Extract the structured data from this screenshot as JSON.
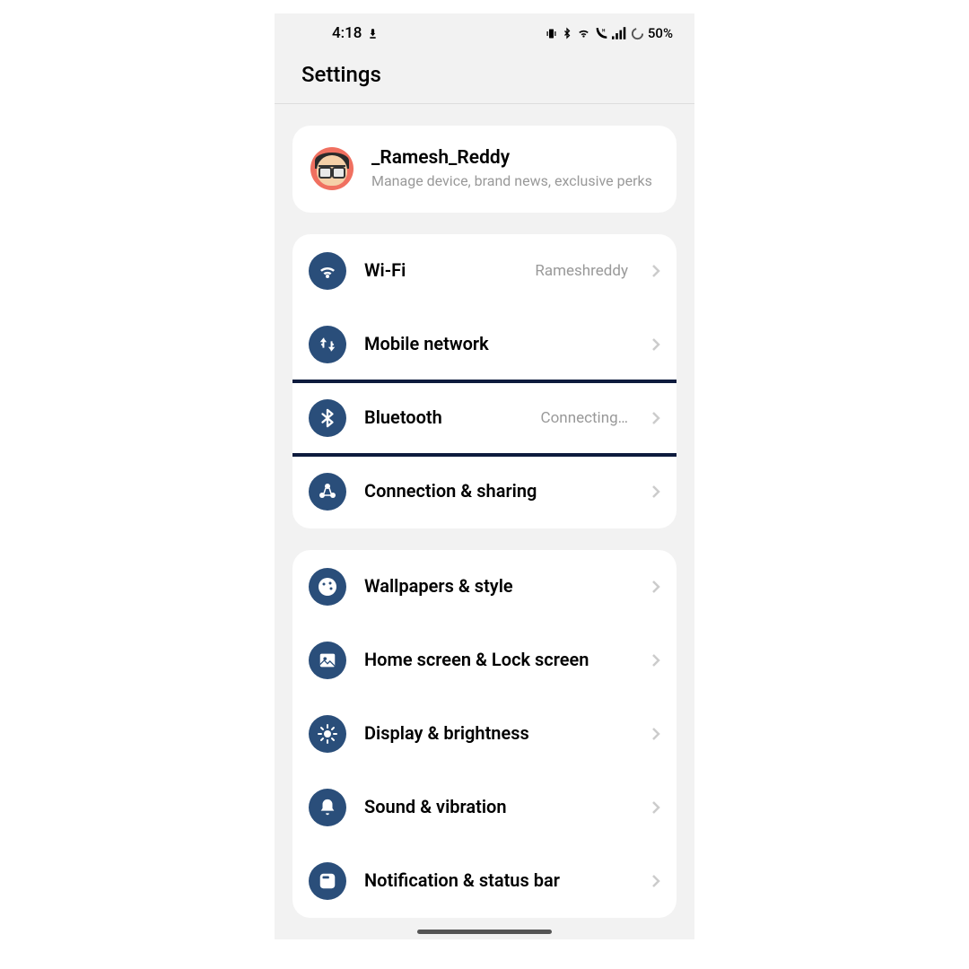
{
  "statusbar": {
    "time": "4:18",
    "battery": "50%"
  },
  "header": {
    "title": "Settings"
  },
  "profile": {
    "name": "_Ramesh_Reddy",
    "desc": "Manage device, brand news, exclusive perks"
  },
  "group1": {
    "wifi": {
      "label": "Wi-Fi",
      "value": "Rameshreddy"
    },
    "mobile": {
      "label": "Mobile network"
    },
    "bluetooth": {
      "label": "Bluetooth",
      "value": "Connecting…"
    },
    "connection": {
      "label": "Connection & sharing"
    }
  },
  "group2": {
    "wallpapers": {
      "label": "Wallpapers & style"
    },
    "home": {
      "label": "Home screen & Lock screen"
    },
    "display": {
      "label": "Display & brightness"
    },
    "sound": {
      "label": "Sound & vibration"
    },
    "notification": {
      "label": "Notification & status bar"
    }
  }
}
